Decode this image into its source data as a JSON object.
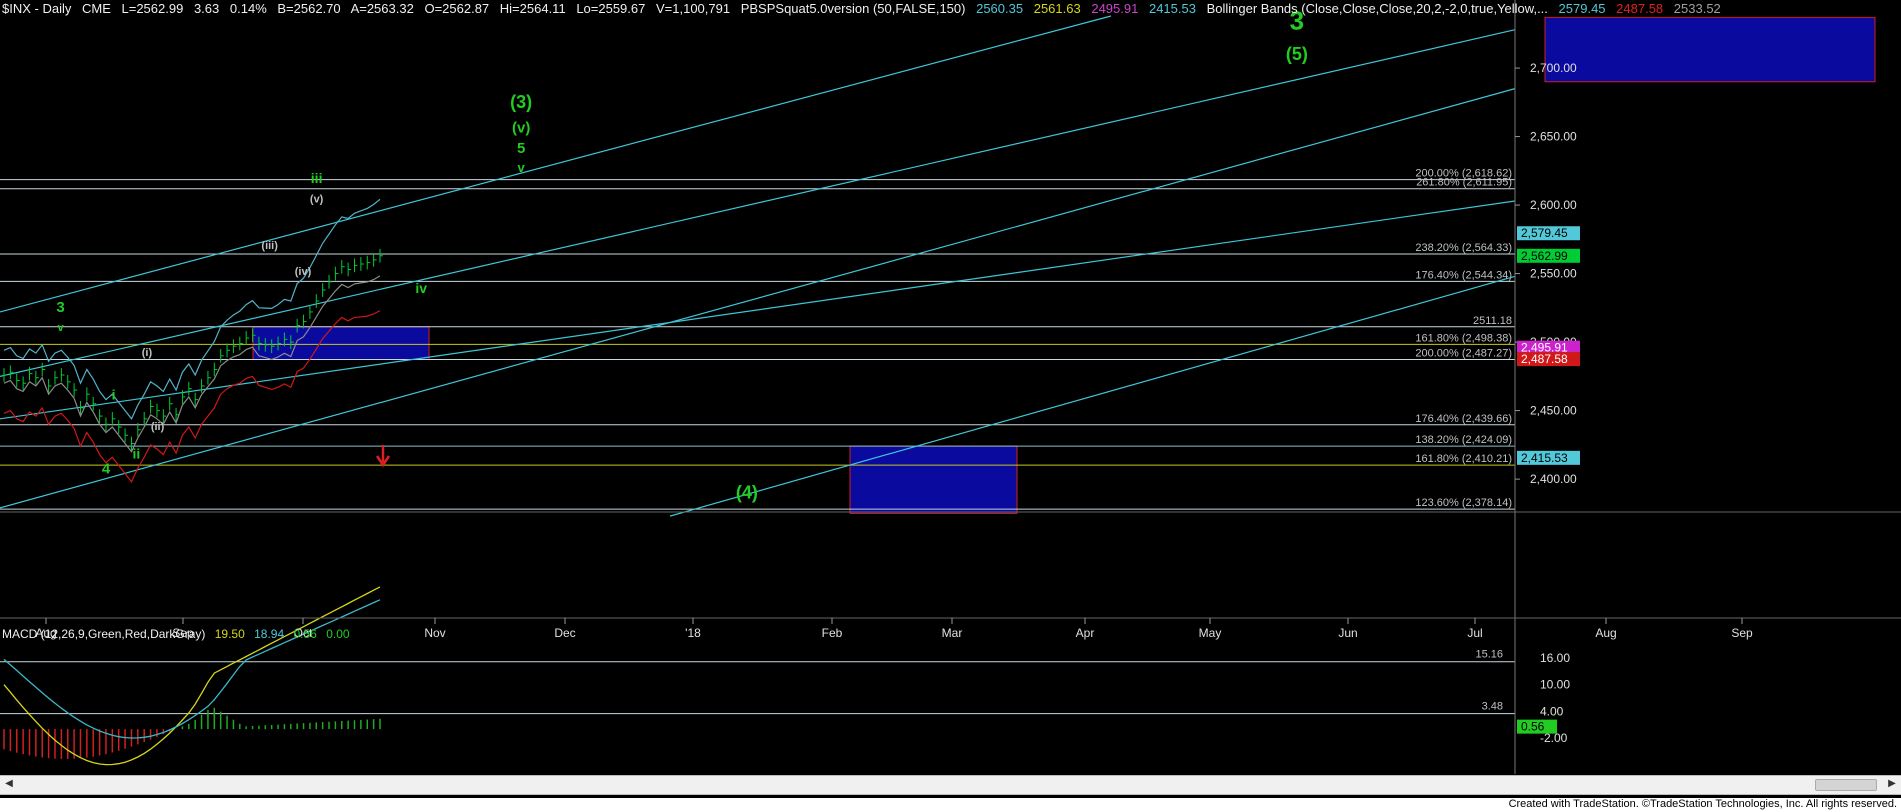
{
  "header": {
    "symbol": "$INX - Daily",
    "exchange": "CME",
    "last": "L=2562.99",
    "change": "3.63",
    "pct": "0.14%",
    "bid": "B=2562.70",
    "ask": "A=2563.32",
    "open": "O=2562.87",
    "high": "Hi=2564.11",
    "low": "Lo=2559.67",
    "volume": "V=1,100,791",
    "indicator1": "PBSPSquat5.0version (50,FALSE,150)",
    "ind1_v1": "2560.35",
    "ind1_v2": "2561.63",
    "ind1_v3": "2495.91",
    "ind1_v4": "2415.53",
    "indicator2": "Bollinger Bands (Close,Close,Close,20,2,-2,0,true,Yellow,...",
    "bb_v1": "2579.45",
    "bb_v2": "2487.58",
    "bb_v3": "2533.52"
  },
  "macd_header": {
    "name": "MACD (12,26,9,Green,Red,DarkGray)",
    "v1": "19.50",
    "v2": "18.94",
    "v3": "0.56",
    "v4": "0.00"
  },
  "colors": {
    "price": "#00cc33",
    "channel": "#3ec6d8",
    "hline": "#c8d8e0",
    "box": "#0a0a9e",
    "label": "#22cc22",
    "bb_upper": "#52b3c8",
    "bb_mid": "#8c8c8c",
    "bb_lower": "#d01818",
    "macd_line": "#d6d619",
    "signal_line": "#3cb8c8",
    "hist": "#22aa22",
    "hist_neg": "#cc2222"
  },
  "footer": "Created with TradeStation. ©TradeStation Technologies, Inc. All rights reserved.",
  "chart_data": {
    "type": "line",
    "series_kind": "ohlc-bars",
    "x_axis": {
      "tick_labels": [
        "Aug",
        "Sep",
        "Oct",
        "Nov",
        "Dec",
        "'18",
        "Feb",
        "Mar",
        "Apr",
        "May",
        "Jun",
        "Jul",
        "Aug",
        "Sep"
      ]
    },
    "y_axis": {
      "tick_labels": [
        "2,700.00",
        "2,650.00",
        "2,600.00",
        "2,550.00",
        "2,500.00",
        "2,450.00",
        "2,400.00"
      ],
      "ylim": [
        2375,
        2740
      ]
    },
    "price_tags": [
      {
        "text": "2,579.45",
        "value": 2579.45,
        "bg": "#52c8d8",
        "fg": "#000000"
      },
      {
        "text": "2,562.99",
        "value": 2562.99,
        "bg": "#00cc33",
        "fg": "#000000"
      },
      {
        "text": "2,495.91",
        "value": 2495.91,
        "bg": "#cc22cc",
        "fg": "#ffffff"
      },
      {
        "text": "2,487.58",
        "value": 2487.58,
        "bg": "#d01818",
        "fg": "#ffffff"
      },
      {
        "text": "2,415.53",
        "value": 2415.53,
        "bg": "#52c8d8",
        "fg": "#000000"
      }
    ],
    "fib_lines": [
      {
        "value": 2618.62,
        "label": "200.00% (2,618.62)",
        "color": "#c8d8e0"
      },
      {
        "value": 2611.95,
        "label": "261.80% (2,611.95)",
        "color": "#c8d8e0"
      },
      {
        "value": 2564.33,
        "label": "238.20% (2,564.33)",
        "color": "#c8d8e0"
      },
      {
        "value": 2544.34,
        "label": "176.40% (2,544.34)",
        "color": "#c8d8e0"
      },
      {
        "value": 2511.18,
        "label": "2511.18",
        "color": "#c8d8e0"
      },
      {
        "value": 2498.38,
        "label": "161.80% (2,498.38)",
        "color": "#c8c820"
      },
      {
        "value": 2487.27,
        "label": "200.00% (2,487.27)",
        "color": "#c8d8e0"
      },
      {
        "value": 2439.66,
        "label": "176.40% (2,439.66)",
        "color": "#c8d8e0"
      },
      {
        "value": 2424.09,
        "label": "138.20% (2,424.09)",
        "color": "#8cc0c8"
      },
      {
        "value": 2410.21,
        "label": "161.80% (2,410.21)",
        "color": "#c8c820"
      },
      {
        "value": 2378.14,
        "label": "123.60% (2,378.14)",
        "color": "#c8d8e0"
      }
    ],
    "wave_labels": [
      {
        "text": "3",
        "x": 0.04,
        "y": 2522,
        "size": 15
      },
      {
        "text": "v",
        "x": 0.04,
        "y": 2508,
        "size": 11
      },
      {
        "text": "4",
        "x": 0.07,
        "y": 2404,
        "size": 15
      },
      {
        "text": "i",
        "x": 0.075,
        "y": 2458,
        "size": 14
      },
      {
        "text": "ii",
        "x": 0.09,
        "y": 2415,
        "size": 14
      },
      {
        "text": "(i)",
        "x": 0.097,
        "y": 2490,
        "size": 11,
        "color": "#c0c0c0"
      },
      {
        "text": "(ii)",
        "x": 0.104,
        "y": 2436,
        "size": 11,
        "color": "#c0c0c0"
      },
      {
        "text": "(iii)",
        "x": 0.178,
        "y": 2568,
        "size": 11,
        "color": "#c0c0c0"
      },
      {
        "text": "(iv)",
        "x": 0.2,
        "y": 2549,
        "size": 11,
        "color": "#c0c0c0"
      },
      {
        "text": "iii",
        "x": 0.209,
        "y": 2616,
        "size": 14
      },
      {
        "text": "(v)",
        "x": 0.209,
        "y": 2602,
        "size": 11,
        "color": "#c0c0c0"
      },
      {
        "text": "iv",
        "x": 0.278,
        "y": 2536,
        "size": 14
      },
      {
        "text": "(3)",
        "x": 0.344,
        "y": 2671,
        "size": 18
      },
      {
        "text": "(v)",
        "x": 0.344,
        "y": 2653,
        "size": 15
      },
      {
        "text": "5",
        "x": 0.344,
        "y": 2638,
        "size": 15
      },
      {
        "text": "v",
        "x": 0.344,
        "y": 2624,
        "size": 13
      },
      {
        "text": "(4)",
        "x": 0.493,
        "y": 2386,
        "size": 18
      },
      {
        "text": "3",
        "x": 0.856,
        "y": 2728,
        "size": 26
      },
      {
        "text": "(5)",
        "x": 0.856,
        "y": 2706,
        "size": 18
      }
    ]
  },
  "macd_axis": {
    "tick_labels": [
      "16.00",
      "10.00",
      "4.00",
      "-2.00"
    ],
    "levels": [
      {
        "value": 15.16,
        "label": "15.16"
      },
      {
        "value": 3.48,
        "label": "3.48"
      }
    ],
    "tag": {
      "text": "0.56",
      "value": 0.56,
      "bg": "#22cc22"
    }
  }
}
